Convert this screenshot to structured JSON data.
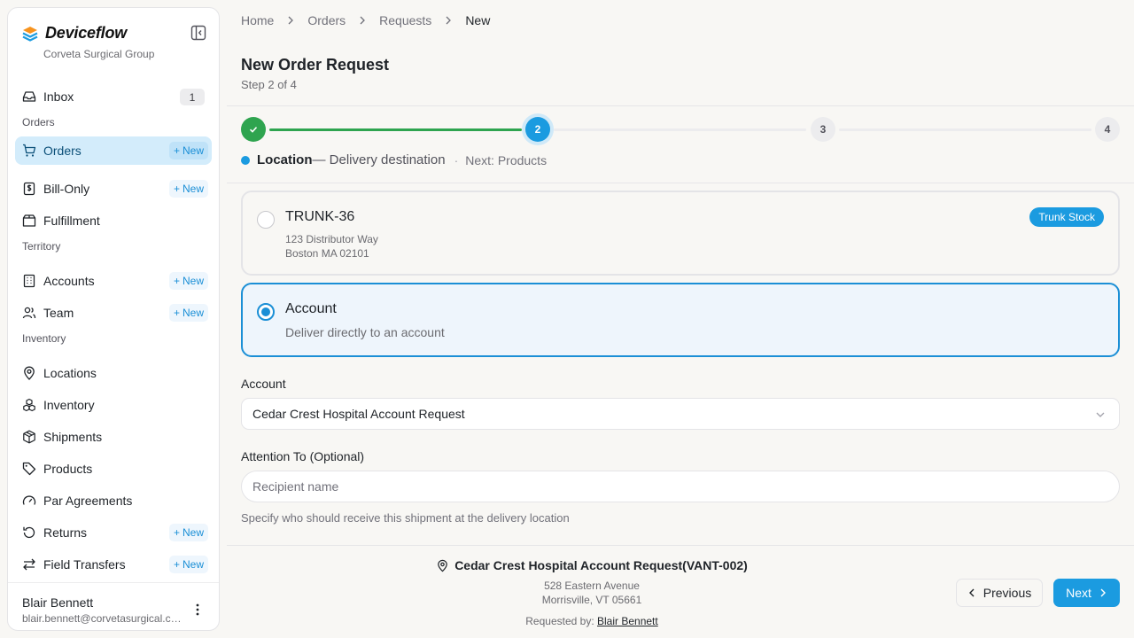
{
  "app": {
    "brand": "Deviceflow",
    "org": "Corveta Surgical Group",
    "brand_icon": "layers-logo-icon",
    "accent": "#1b9be0",
    "success": "#2ea44f"
  },
  "sidebar": {
    "inbox": {
      "label": "Inbox",
      "count": "1",
      "icon": "inbox-icon"
    },
    "sections": {
      "orders": "Orders",
      "territory": "Territory",
      "inventory": "Inventory"
    },
    "new_label": "New",
    "items": [
      {
        "label": "Orders",
        "icon": "cart-icon",
        "new": true,
        "active": true
      },
      {
        "label": "Bill-Only",
        "icon": "receipt-icon",
        "new": true
      },
      {
        "label": "Fulfillment",
        "icon": "box-open-icon",
        "new": false
      },
      {
        "label": "Accounts",
        "icon": "building-icon",
        "new": true
      },
      {
        "label": "Team",
        "icon": "users-icon",
        "new": true
      },
      {
        "label": "Locations",
        "icon": "map-pin-icon",
        "new": false
      },
      {
        "label": "Inventory",
        "icon": "cubes-icon",
        "new": false
      },
      {
        "label": "Shipments",
        "icon": "package-icon",
        "new": false
      },
      {
        "label": "Products",
        "icon": "tag-icon",
        "new": false
      },
      {
        "label": "Par Agreements",
        "icon": "gauge-icon",
        "new": false
      },
      {
        "label": "Returns",
        "icon": "return-icon",
        "new": true
      },
      {
        "label": "Field Transfers",
        "icon": "transfer-icon",
        "new": true
      }
    ],
    "user": {
      "name": "Blair Bennett",
      "email": "blair.bennett@corvetasurgical.com"
    }
  },
  "breadcrumb": [
    "Home",
    "Orders",
    "Requests",
    "New"
  ],
  "page": {
    "title": "New Order Request",
    "step": "Step 2 of 4"
  },
  "stepper": {
    "steps": [
      "1",
      "2",
      "3",
      "4"
    ],
    "current": 2,
    "caption_title": "Location",
    "caption_sub": "— Delivery destination",
    "caption_sep": "·",
    "caption_next": "Next: Products"
  },
  "options": {
    "trunk": {
      "title": "TRUNK-36",
      "line1": "123 Distributor Way",
      "line2": "Boston MA 02101",
      "badge": "Trunk Stock",
      "selected": false
    },
    "account": {
      "title": "Account",
      "subtitle": "Deliver directly to an account",
      "selected": true
    }
  },
  "form": {
    "account_label": "Account",
    "account_value": "Cedar Crest Hospital Account Request",
    "attention_label": "Attention To (Optional)",
    "attention_placeholder": "Recipient name",
    "attention_value": "",
    "attention_helper": "Specify who should receive this shipment at the delivery location"
  },
  "footer": {
    "dest_name": "Cedar Crest Hospital Account Request(VANT-002)",
    "dest_line1": "528 Eastern Avenue",
    "dest_line2": "Morrisville, VT 05661",
    "requested_by_label": "Requested by:",
    "requested_by": "Blair Bennett",
    "prev_label": "Previous",
    "next_label": "Next"
  }
}
